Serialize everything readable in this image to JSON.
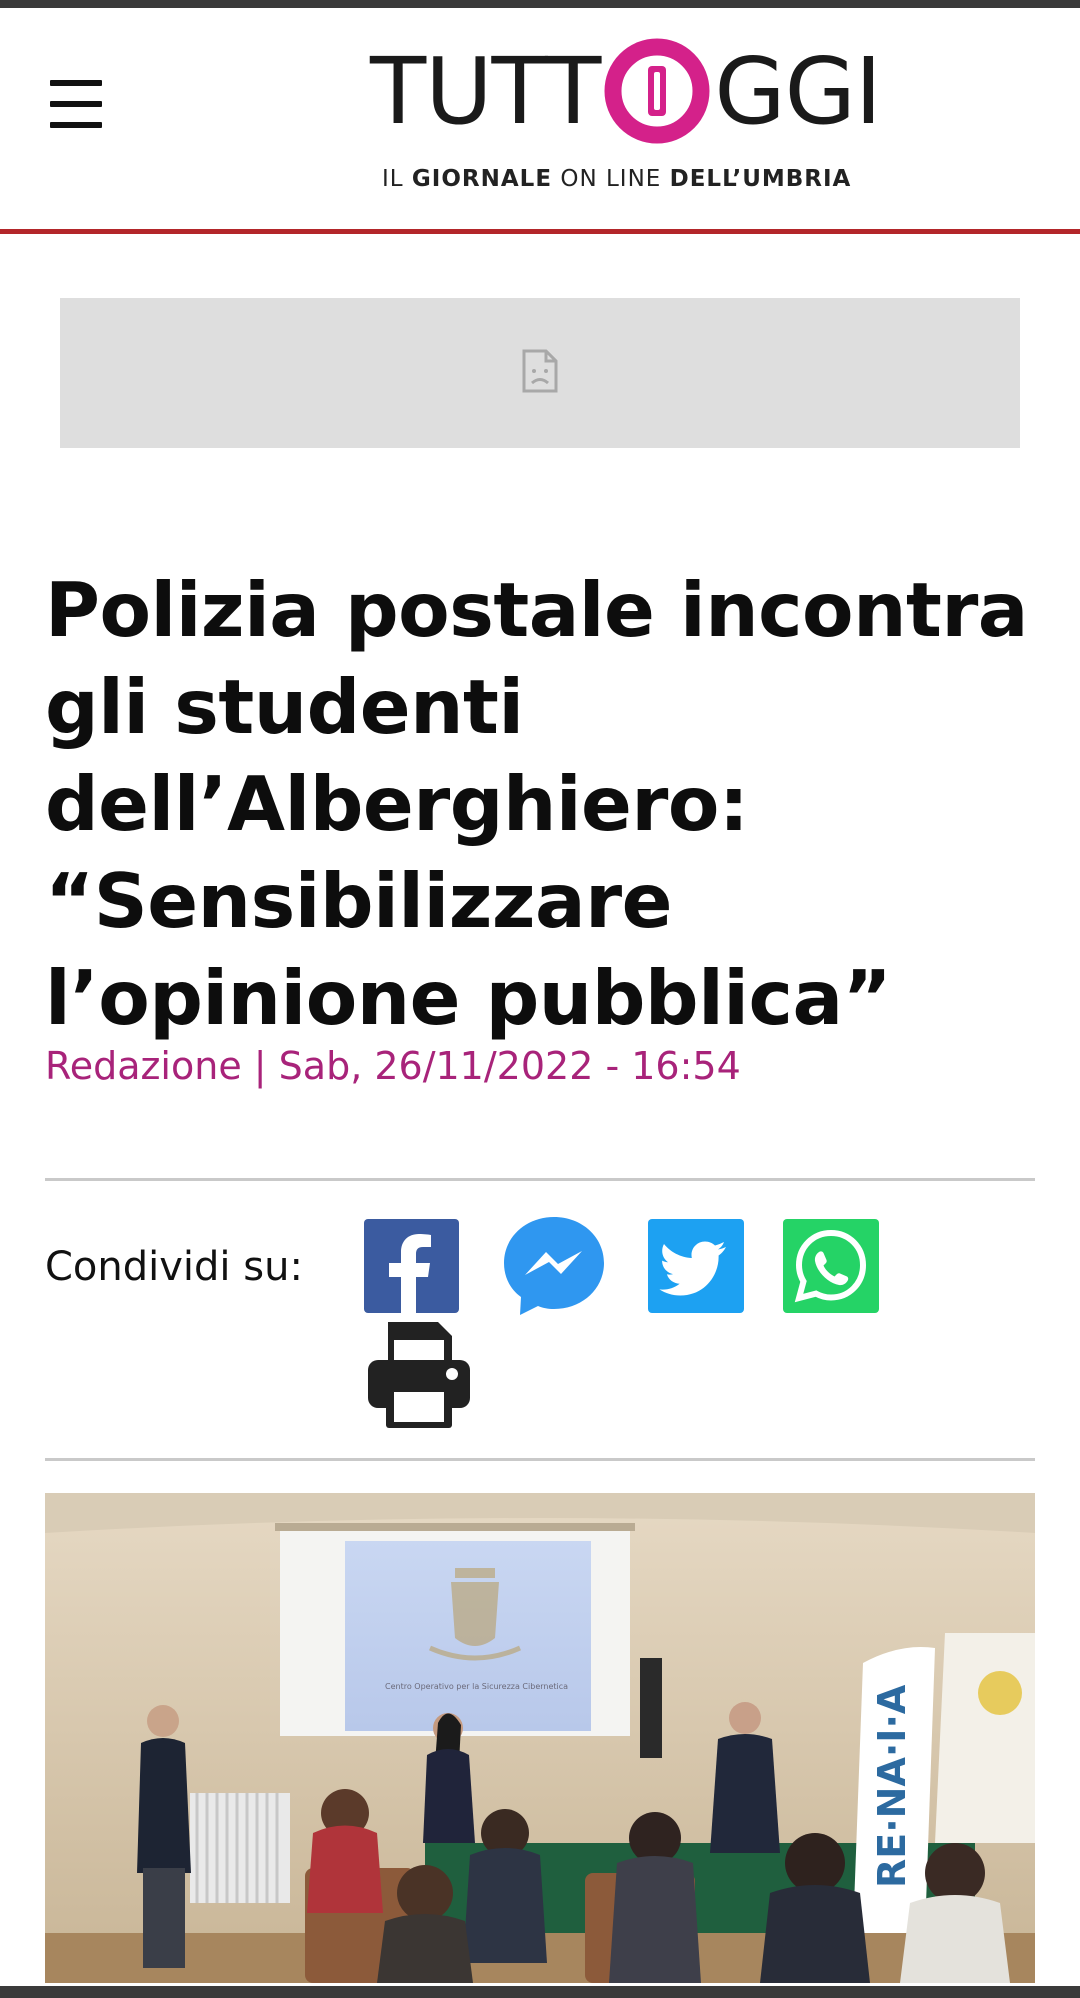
{
  "brand": {
    "logo_text_left": "TUTT",
    "logo_text_right": "GGI",
    "tagline_part1": "IL ",
    "tagline_bold1": "GIORNALE",
    "tagline_part2": " ON LINE ",
    "tagline_bold2": "DELL’UMBRIA",
    "accent_color": "#b3262a",
    "logo_color": "#d4218a"
  },
  "menu": {
    "icon": "hamburger-menu-icon"
  },
  "ad": {
    "icon": "broken-document-icon"
  },
  "article": {
    "title": "Polizia postale incontra gli studenti dell’Alberghiero: “Sensibilizzare l’opinione pubblica”",
    "byline": "Redazione | Sab, 26/11/2022 - 16:54",
    "byline_color": "#a8237a"
  },
  "share": {
    "label": "Condividi su:",
    "buttons": [
      {
        "icon": "facebook-icon",
        "color": "#3b5ba0"
      },
      {
        "icon": "messenger-icon",
        "color": "#2f97f0"
      },
      {
        "icon": "twitter-icon",
        "color": "#1da1f2"
      },
      {
        "icon": "whatsapp-icon",
        "color": "#25d366"
      },
      {
        "icon": "print-icon",
        "color": "#222222"
      }
    ]
  },
  "hero_image": {
    "banner_text": "RE·NA·I·A",
    "screen_text": "Centro Operativo per la Sicurezza Cibernetica"
  }
}
